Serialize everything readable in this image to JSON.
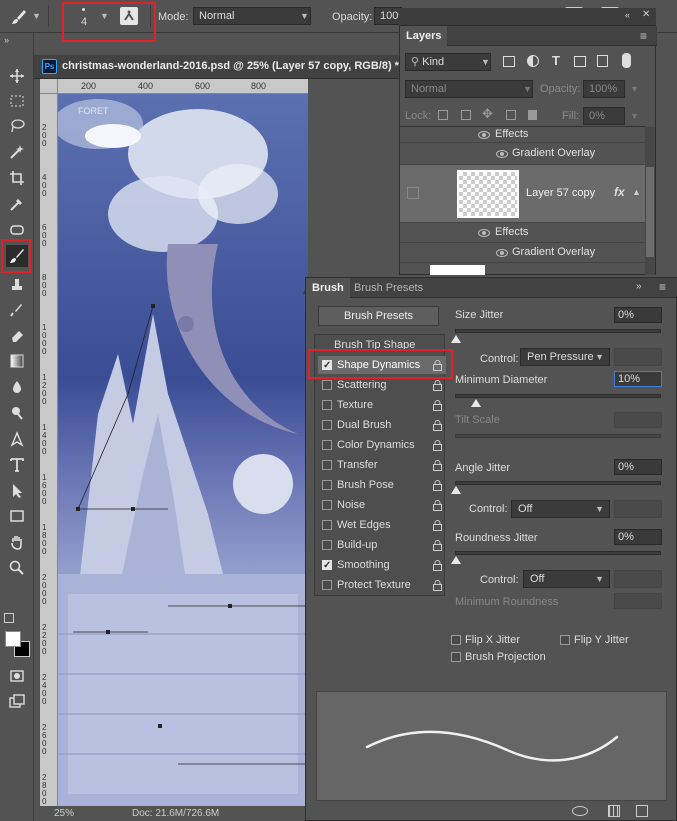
{
  "options_bar": {
    "brush_size": "4",
    "mode_label": "Mode:",
    "mode_value": "Normal",
    "opacity_label": "Opacity:",
    "opacity_value": "100%"
  },
  "document": {
    "tab_title": "christmas-wonderland-2016.psd @ 25% (Layer 57 copy, RGB/8) *",
    "ps_badge": "Ps",
    "ruler_ticks": [
      "200",
      "400",
      "600",
      "800"
    ],
    "vertical_ruler_ticks": [
      "200",
      "400",
      "600",
      "800",
      "1000",
      "1200",
      "1400",
      "1600",
      "1800",
      "2000",
      "2200",
      "2400",
      "2600",
      "2800"
    ],
    "canvas_text": "FORET",
    "zoom": "25%",
    "doc_size": "Doc: 21.6M/726.6M"
  },
  "layers_panel": {
    "tab": "Layers",
    "filter_kind": "Kind",
    "blend_mode": "Normal",
    "opacity_label": "Opacity:",
    "opacity_value": "100%",
    "lock_label": "Lock:",
    "fill_label": "Fill:",
    "fill_value": "0%",
    "rows": [
      {
        "label": "Effects"
      },
      {
        "label": "Gradient Overlay"
      },
      {
        "label": "Layer 57 copy"
      },
      {
        "label": "Effects"
      },
      {
        "label": "Gradient Overlay"
      }
    ],
    "fx_label": "fx"
  },
  "brush_panel": {
    "tabs": [
      "Brush",
      "Brush Presets"
    ],
    "presets_button": "Brush Presets",
    "header_item": "Brush Tip Shape",
    "options": [
      {
        "label": "Shape Dynamics",
        "checked": true,
        "selected": true
      },
      {
        "label": "Scattering",
        "checked": false
      },
      {
        "label": "Texture",
        "checked": false
      },
      {
        "label": "Dual Brush",
        "checked": false
      },
      {
        "label": "Color Dynamics",
        "checked": false
      },
      {
        "label": "Transfer",
        "checked": false
      },
      {
        "label": "Brush Pose",
        "checked": false
      },
      {
        "label": "Noise",
        "checked": false
      },
      {
        "label": "Wet Edges",
        "checked": false
      },
      {
        "label": "Build-up",
        "checked": false
      },
      {
        "label": "Smoothing",
        "checked": true
      },
      {
        "label": "Protect Texture",
        "checked": false
      }
    ],
    "size_jitter": {
      "label": "Size Jitter",
      "value": "0%"
    },
    "control_label": "Control:",
    "control_1": "Pen Pressure",
    "min_diameter": {
      "label": "Minimum Diameter",
      "value": "10%"
    },
    "tilt_scale": "Tilt Scale",
    "angle_jitter": {
      "label": "Angle Jitter",
      "value": "0%"
    },
    "control_2": "Off",
    "roundness_jitter": {
      "label": "Roundness Jitter",
      "value": "0%"
    },
    "control_3": "Off",
    "min_roundness": "Minimum Roundness",
    "flip_x": "Flip X Jitter",
    "flip_y": "Flip Y Jitter",
    "brush_projection": "Brush Projection"
  },
  "colors": {
    "panel_bg": "#535353",
    "highlight_red": "#e0202a",
    "selected_row": "#6b6b6b"
  }
}
